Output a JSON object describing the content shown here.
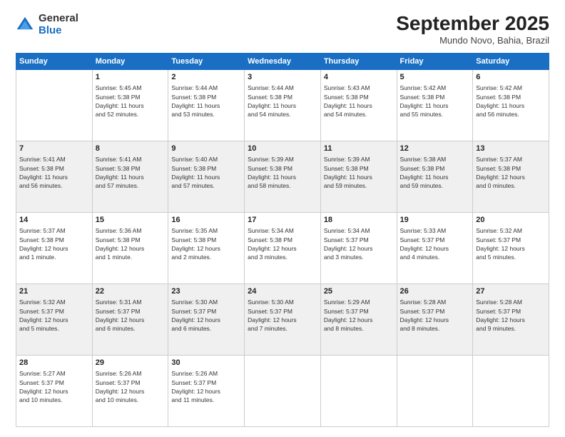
{
  "logo": {
    "general": "General",
    "blue": "Blue"
  },
  "header": {
    "month": "September 2025",
    "location": "Mundo Novo, Bahia, Brazil"
  },
  "days": [
    "Sunday",
    "Monday",
    "Tuesday",
    "Wednesday",
    "Thursday",
    "Friday",
    "Saturday"
  ],
  "weeks": [
    [
      {
        "num": "",
        "info": ""
      },
      {
        "num": "1",
        "info": "Sunrise: 5:45 AM\nSunset: 5:38 PM\nDaylight: 11 hours\nand 52 minutes."
      },
      {
        "num": "2",
        "info": "Sunrise: 5:44 AM\nSunset: 5:38 PM\nDaylight: 11 hours\nand 53 minutes."
      },
      {
        "num": "3",
        "info": "Sunrise: 5:44 AM\nSunset: 5:38 PM\nDaylight: 11 hours\nand 54 minutes."
      },
      {
        "num": "4",
        "info": "Sunrise: 5:43 AM\nSunset: 5:38 PM\nDaylight: 11 hours\nand 54 minutes."
      },
      {
        "num": "5",
        "info": "Sunrise: 5:42 AM\nSunset: 5:38 PM\nDaylight: 11 hours\nand 55 minutes."
      },
      {
        "num": "6",
        "info": "Sunrise: 5:42 AM\nSunset: 5:38 PM\nDaylight: 11 hours\nand 56 minutes."
      }
    ],
    [
      {
        "num": "7",
        "info": "Sunrise: 5:41 AM\nSunset: 5:38 PM\nDaylight: 11 hours\nand 56 minutes."
      },
      {
        "num": "8",
        "info": "Sunrise: 5:41 AM\nSunset: 5:38 PM\nDaylight: 11 hours\nand 57 minutes."
      },
      {
        "num": "9",
        "info": "Sunrise: 5:40 AM\nSunset: 5:38 PM\nDaylight: 11 hours\nand 57 minutes."
      },
      {
        "num": "10",
        "info": "Sunrise: 5:39 AM\nSunset: 5:38 PM\nDaylight: 11 hours\nand 58 minutes."
      },
      {
        "num": "11",
        "info": "Sunrise: 5:39 AM\nSunset: 5:38 PM\nDaylight: 11 hours\nand 59 minutes."
      },
      {
        "num": "12",
        "info": "Sunrise: 5:38 AM\nSunset: 5:38 PM\nDaylight: 11 hours\nand 59 minutes."
      },
      {
        "num": "13",
        "info": "Sunrise: 5:37 AM\nSunset: 5:38 PM\nDaylight: 12 hours\nand 0 minutes."
      }
    ],
    [
      {
        "num": "14",
        "info": "Sunrise: 5:37 AM\nSunset: 5:38 PM\nDaylight: 12 hours\nand 1 minute."
      },
      {
        "num": "15",
        "info": "Sunrise: 5:36 AM\nSunset: 5:38 PM\nDaylight: 12 hours\nand 1 minute."
      },
      {
        "num": "16",
        "info": "Sunrise: 5:35 AM\nSunset: 5:38 PM\nDaylight: 12 hours\nand 2 minutes."
      },
      {
        "num": "17",
        "info": "Sunrise: 5:34 AM\nSunset: 5:38 PM\nDaylight: 12 hours\nand 3 minutes."
      },
      {
        "num": "18",
        "info": "Sunrise: 5:34 AM\nSunset: 5:37 PM\nDaylight: 12 hours\nand 3 minutes."
      },
      {
        "num": "19",
        "info": "Sunrise: 5:33 AM\nSunset: 5:37 PM\nDaylight: 12 hours\nand 4 minutes."
      },
      {
        "num": "20",
        "info": "Sunrise: 5:32 AM\nSunset: 5:37 PM\nDaylight: 12 hours\nand 5 minutes."
      }
    ],
    [
      {
        "num": "21",
        "info": "Sunrise: 5:32 AM\nSunset: 5:37 PM\nDaylight: 12 hours\nand 5 minutes."
      },
      {
        "num": "22",
        "info": "Sunrise: 5:31 AM\nSunset: 5:37 PM\nDaylight: 12 hours\nand 6 minutes."
      },
      {
        "num": "23",
        "info": "Sunrise: 5:30 AM\nSunset: 5:37 PM\nDaylight: 12 hours\nand 6 minutes."
      },
      {
        "num": "24",
        "info": "Sunrise: 5:30 AM\nSunset: 5:37 PM\nDaylight: 12 hours\nand 7 minutes."
      },
      {
        "num": "25",
        "info": "Sunrise: 5:29 AM\nSunset: 5:37 PM\nDaylight: 12 hours\nand 8 minutes."
      },
      {
        "num": "26",
        "info": "Sunrise: 5:28 AM\nSunset: 5:37 PM\nDaylight: 12 hours\nand 8 minutes."
      },
      {
        "num": "27",
        "info": "Sunrise: 5:28 AM\nSunset: 5:37 PM\nDaylight: 12 hours\nand 9 minutes."
      }
    ],
    [
      {
        "num": "28",
        "info": "Sunrise: 5:27 AM\nSunset: 5:37 PM\nDaylight: 12 hours\nand 10 minutes."
      },
      {
        "num": "29",
        "info": "Sunrise: 5:26 AM\nSunset: 5:37 PM\nDaylight: 12 hours\nand 10 minutes."
      },
      {
        "num": "30",
        "info": "Sunrise: 5:26 AM\nSunset: 5:37 PM\nDaylight: 12 hours\nand 11 minutes."
      },
      {
        "num": "",
        "info": ""
      },
      {
        "num": "",
        "info": ""
      },
      {
        "num": "",
        "info": ""
      },
      {
        "num": "",
        "info": ""
      }
    ]
  ]
}
